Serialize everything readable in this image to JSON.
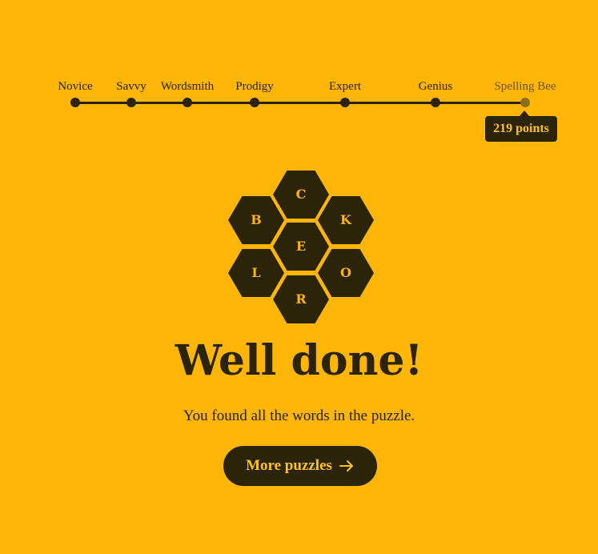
{
  "progress": {
    "ranks": [
      {
        "label": "Novice"
      },
      {
        "label": "Savvy"
      },
      {
        "label": "Wordsmith"
      },
      {
        "label": "Prodigy"
      },
      {
        "label": "Expert"
      },
      {
        "label": "Genius"
      },
      {
        "label": "Spelling Bee"
      }
    ],
    "current_rank": "Spelling Bee",
    "points_label": "219 points"
  },
  "hive": {
    "center_letter": "E",
    "outer_letters": [
      "C",
      "K",
      "O",
      "R",
      "L",
      "B"
    ]
  },
  "result": {
    "headline": "Well done!",
    "message": "You found all the words in the puzzle.",
    "button_label": "More puzzles",
    "button_icon": "arrow-right-icon"
  },
  "colors": {
    "background": "#ffb607",
    "dark": "#2b2409",
    "accent": "#ffc414"
  }
}
